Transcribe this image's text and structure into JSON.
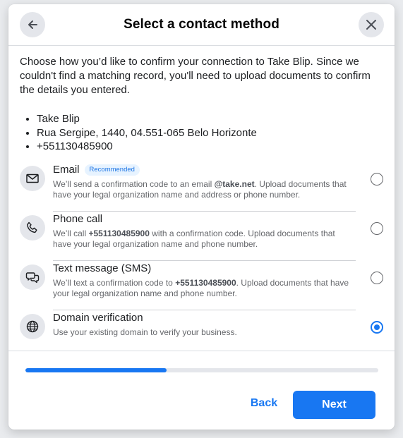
{
  "dialog": {
    "title": "Select a contact method",
    "intro": "Choose how you’d like to confirm your connection to Take Blip. Since we couldn't find a matching record, you'll need to upload documents to confirm the details you entered."
  },
  "details": [
    "Take Blip",
    "Rua Sergipe, 1440, 04.551-065 Belo Horizonte",
    "+551130485900"
  ],
  "options": [
    {
      "title": "Email",
      "badge": "Recommended",
      "desc_pre": "We’ll send a confirmation code to an email ",
      "desc_bold": "@take.net",
      "desc_post": ". Upload documents that have your legal organization name and address or phone number.",
      "icon": "envelope-icon",
      "selected": false
    },
    {
      "title": "Phone call",
      "desc_pre": "We’ll call ",
      "desc_bold": "+551130485900",
      "desc_post": " with a confirmation code. Upload documents that have your legal organization name and phone number.",
      "icon": "phone-icon",
      "selected": false
    },
    {
      "title": "Text message (SMS)",
      "desc_pre": "We’ll text a confirmation code to ",
      "desc_bold": "+551130485900",
      "desc_post": ". Upload documents that have your legal organization name and phone number.",
      "icon": "chat-bubbles-icon",
      "selected": false
    },
    {
      "title": "Domain verification",
      "desc_pre": "Use your existing domain to verify your business.",
      "desc_bold": "",
      "desc_post": "",
      "icon": "globe-icon",
      "selected": true
    }
  ],
  "progress": {
    "fraction": 0.4
  },
  "footer": {
    "back_label": "Back",
    "next_label": "Next"
  },
  "colors": {
    "accent": "#1877f2",
    "badge_bg": "#e7f3ff"
  }
}
